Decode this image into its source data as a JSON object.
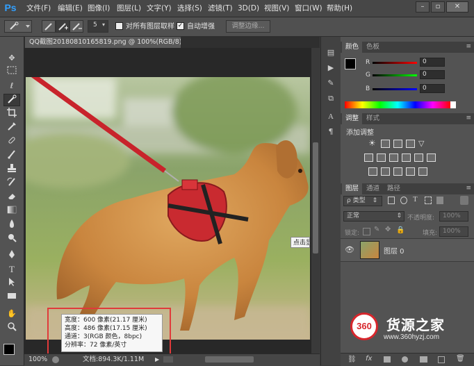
{
  "app": {
    "logo": "Ps"
  },
  "menu": [
    "文件(F)",
    "编辑(E)",
    "图像(I)",
    "图层(L)",
    "文字(Y)",
    "选择(S)",
    "滤镜(T)",
    "3D(D)",
    "视图(V)",
    "窗口(W)",
    "帮助(H)"
  ],
  "window_controls": {
    "minimize": "–",
    "restore": "▫",
    "close": "✕"
  },
  "options_bar": {
    "brush_size": "5",
    "sample_all_layers_label": "对所有图层取样",
    "auto_enhance_label": "自动增强",
    "auto_enhance_checked": true,
    "refine_edge_button": "调整边缘..."
  },
  "document": {
    "tab_title": "QQ截图20180810165819.png @ 100%(RGB/8) *",
    "tab_close": "×",
    "zoom": "100%",
    "doc_info": "文档:894.3K/1.11M",
    "tooltip_partial": "点击显",
    "image_info": {
      "width": "宽度：600 像素(21.17 厘米)",
      "height": "高度：486 像素(17.15 厘米)",
      "channels": "通道：3(RGB 颜色，8bpc)",
      "resolution": "分辨率：72 像素/英寸"
    }
  },
  "panels": {
    "color": {
      "tabs": [
        "颜色",
        "色板"
      ],
      "channels": [
        {
          "label": "R",
          "value": "0"
        },
        {
          "label": "G",
          "value": "0"
        },
        {
          "label": "B",
          "value": "0"
        }
      ]
    },
    "adjustments": {
      "tabs": [
        "调整",
        "样式"
      ],
      "title": "添加调整"
    },
    "layers": {
      "tabs": [
        "图层",
        "通道",
        "路径"
      ],
      "filter_type": "类型",
      "blend_mode": "正常",
      "opacity_label": "不透明度:",
      "opacity_value": "100%",
      "lock_label": "锁定:",
      "fill_label": "填充:",
      "fill_value": "100%",
      "layer_name": "图层 0",
      "bottom_fx": "fx"
    }
  },
  "watermark": {
    "logo_text": "360",
    "brand": "货源之家",
    "url": "www.360hyzj.com"
  },
  "colors": {
    "accent": "#32a0ff",
    "annotation_red": "#e03a3a",
    "watermark_red": "#d7262c"
  }
}
